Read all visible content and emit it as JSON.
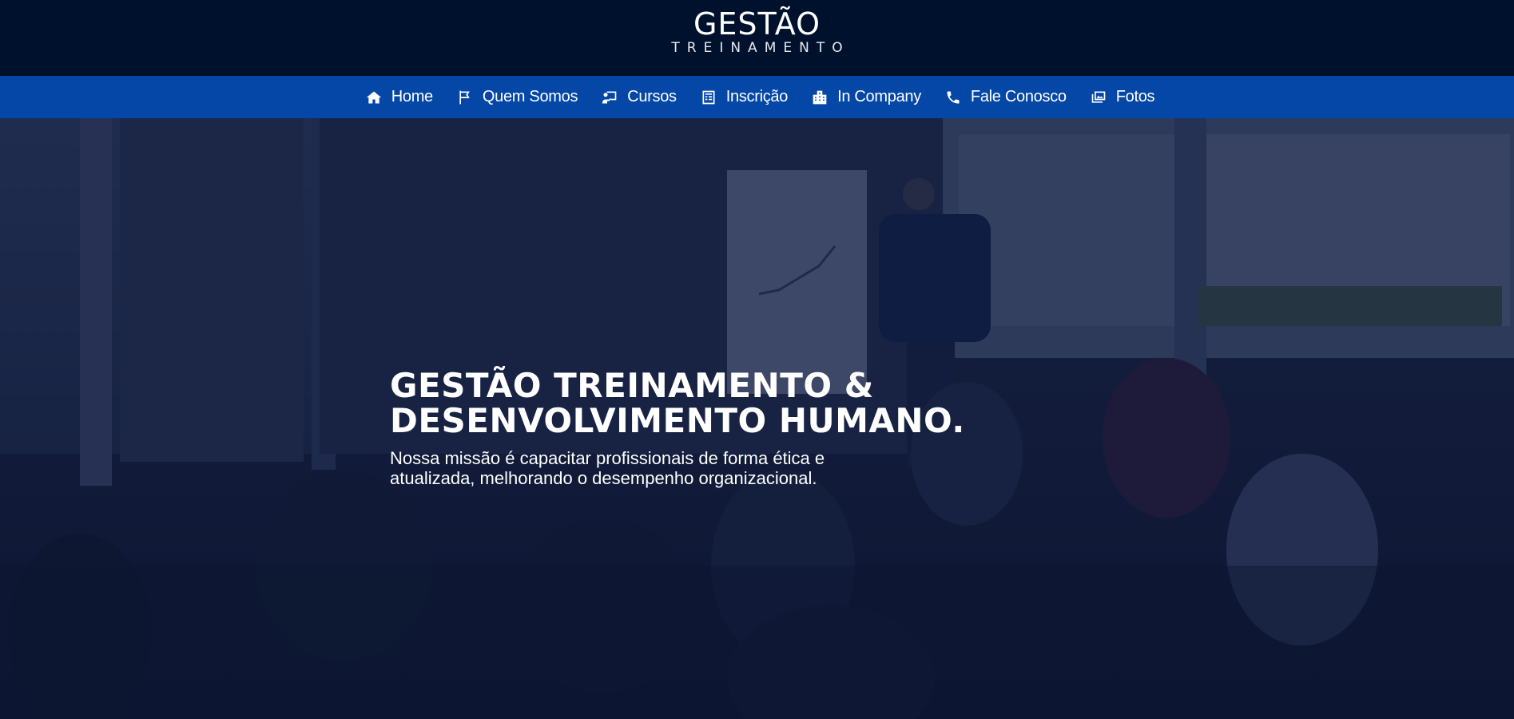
{
  "brand": {
    "name": "GESTÃO",
    "tagline": "TREINAMENTO"
  },
  "nav": {
    "items": [
      {
        "label": "Home",
        "icon": "home-icon"
      },
      {
        "label": "Quem Somos",
        "icon": "flag-icon"
      },
      {
        "label": "Cursos",
        "icon": "chalkboard-teacher-icon"
      },
      {
        "label": "Inscrição",
        "icon": "form-icon"
      },
      {
        "label": "In Company",
        "icon": "building-icon"
      },
      {
        "label": "Fale Conosco",
        "icon": "phone-icon"
      },
      {
        "label": "Fotos",
        "icon": "photos-icon"
      }
    ]
  },
  "hero": {
    "title_line1": "GESTÃO TREINAMENTO &",
    "title_line2": "DESENVOLVIMENTO HUMANO.",
    "subtitle": "Nossa missão é capacitar profissionais de forma ética e atualizada, melhorando o desempenho organizacional."
  },
  "colors": {
    "header_bg": "#00112d",
    "nav_bg": "#0447a6",
    "hero_overlay": "#081234"
  }
}
